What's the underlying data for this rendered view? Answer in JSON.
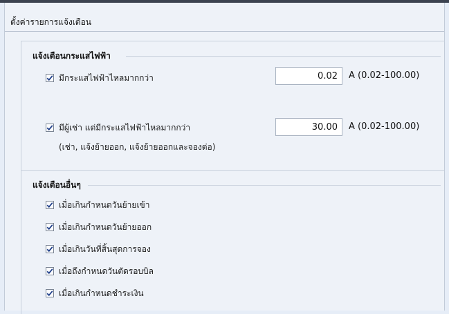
{
  "window": {
    "title": "ตั้งค่ารายการแจ้งเตือน"
  },
  "current_alerts": {
    "heading": "แจ้งเตือนกระแสไฟฟ้า",
    "items": [
      {
        "label": "มีกระแสไฟฟ้าไหลมากกว่า",
        "checked": true,
        "value": "0.02",
        "unit_range": "A (0.02-100.00)"
      },
      {
        "label": "มีผู้เช่า แต่มีกระแสไฟฟ้าไหลมากกว่า",
        "checked": true,
        "value": "30.00",
        "unit_range": "A (0.02-100.00)",
        "note": "(เช่า, แจ้งย้ายออก, แจ้งย้ายออกและจองต่อ)"
      }
    ]
  },
  "other_alerts": {
    "heading": "แจ้งเตือนอื่นๆ",
    "items": [
      {
        "label": "เมื่อเกินกำหนดวันย้ายเข้า",
        "checked": true
      },
      {
        "label": "เมื่อเกินกำหนดวันย้ายออก",
        "checked": true
      },
      {
        "label": "เมื่อเกินวันที่สิ้นสุดการจอง",
        "checked": true
      },
      {
        "label": "เมื่อถึงกำหนดวันตัดรอบบิล",
        "checked": true
      },
      {
        "label": "เมื่อเกินกำหนดชำระเงิน",
        "checked": true
      }
    ]
  },
  "colors": {
    "background": "#e6edf7",
    "panel": "#eef2f8",
    "check": "#1f3f8a"
  },
  "icons": {
    "checkbox_checked": "checkmark-icon"
  }
}
